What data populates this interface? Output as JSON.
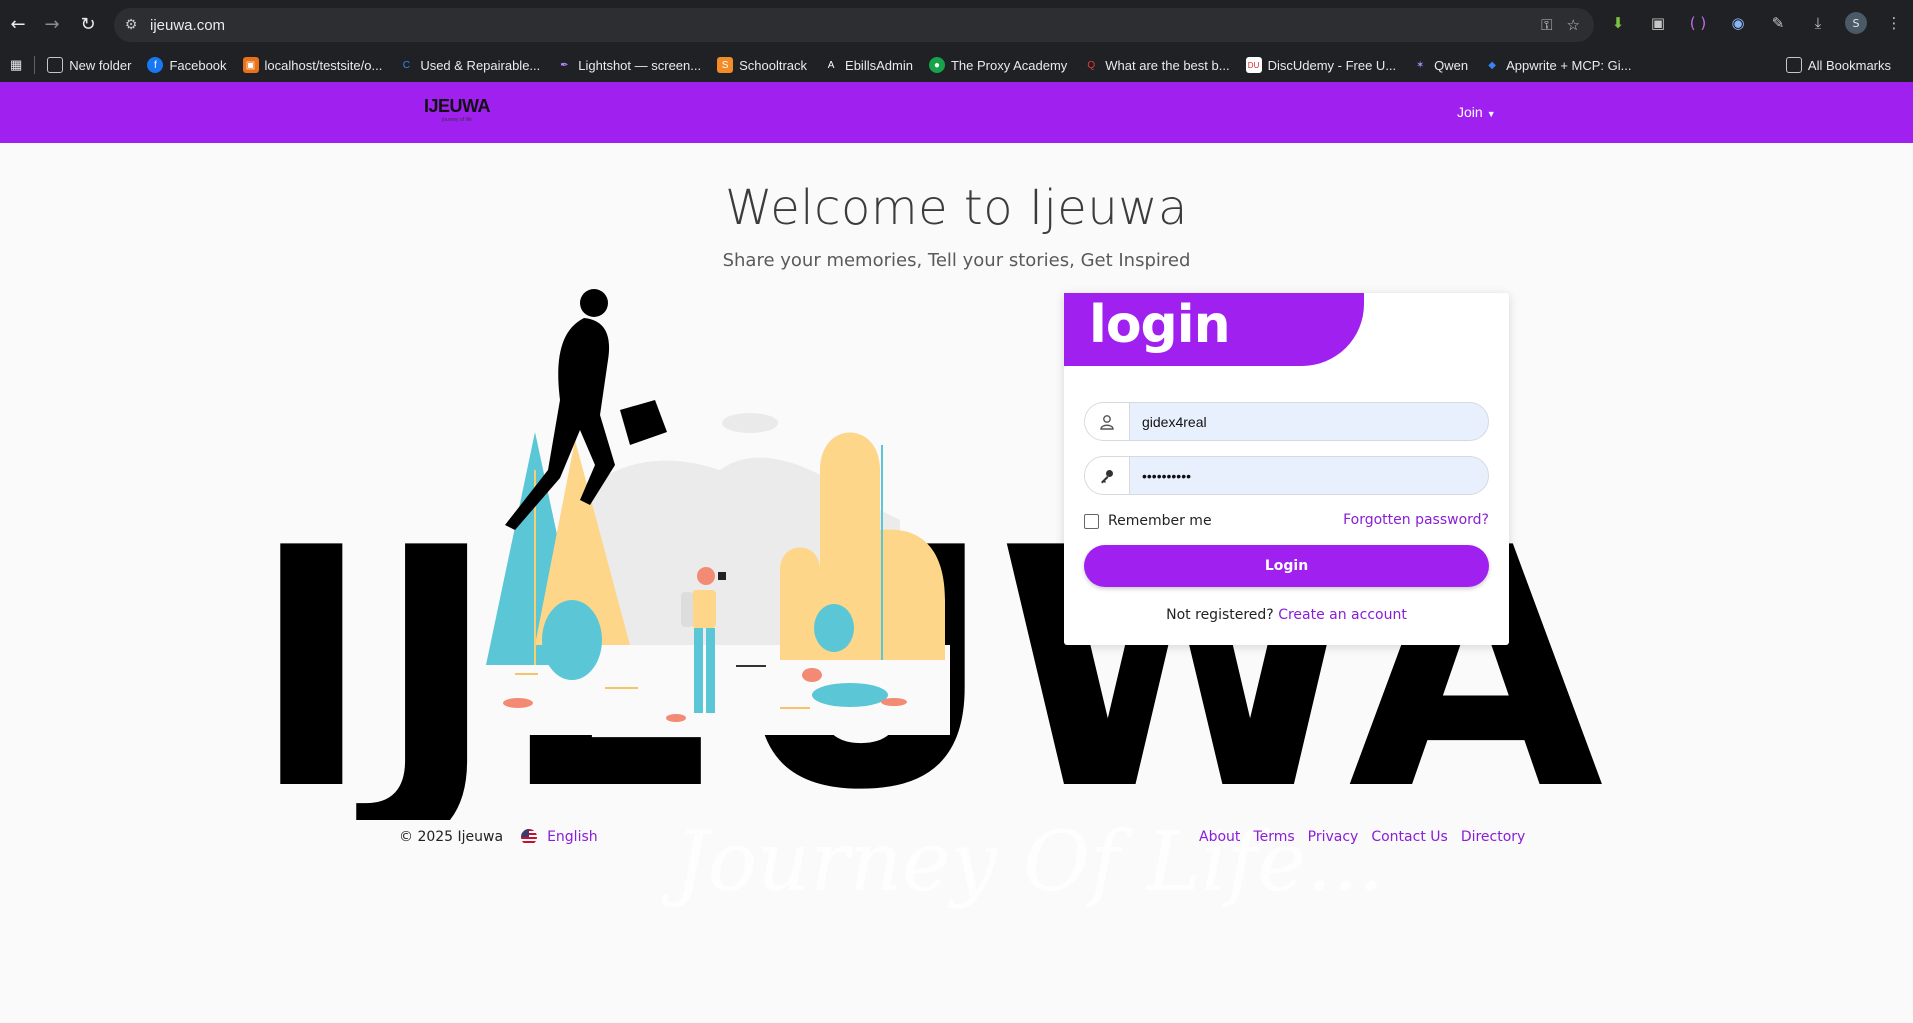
{
  "browser": {
    "url": "ijeuwa.com",
    "profile_initial": "S",
    "bookmarks": [
      {
        "label": "New folder",
        "icon": "folder-icon"
      },
      {
        "label": "Facebook",
        "icon": "facebook-icon"
      },
      {
        "label": "localhost/testsite/o...",
        "icon": "localhost-icon"
      },
      {
        "label": "Used & Repairable...",
        "icon": "used-repairable-icon"
      },
      {
        "label": "Lightshot — screen...",
        "icon": "lightshot-icon"
      },
      {
        "label": "Schooltrack",
        "icon": "schooltrack-icon"
      },
      {
        "label": "EbillsAdmin",
        "icon": "ebills-icon"
      },
      {
        "label": "The Proxy Academy",
        "icon": "proxy-academy-icon"
      },
      {
        "label": "What are the best b...",
        "icon": "quora-icon"
      },
      {
        "label": "DiscUdemy - Free U...",
        "icon": "discudemy-icon"
      },
      {
        "label": "Qwen",
        "icon": "qwen-icon"
      },
      {
        "label": "Appwrite + MCP: Gi...",
        "icon": "appwrite-icon"
      }
    ],
    "all_bookmarks": "All Bookmarks"
  },
  "header": {
    "logo_text": "IJEUWA",
    "logo_sub": "journey of life",
    "join_label": "Join"
  },
  "hero": {
    "title": "Welcome to Ijeuwa",
    "subtitle": "Share your memories, Tell your stories, Get Inspired",
    "big_word": "IJEUWA",
    "tagline": "Journey Of Life..."
  },
  "login": {
    "heading": "login",
    "username_value": "gidex4real",
    "password_value": "••••••••••",
    "remember_label": "Remember me",
    "forgot_label": "Forgotten password?",
    "button_label": "Login",
    "not_registered": "Not registered?",
    "create_account": "Create an account"
  },
  "footer": {
    "copyright": "© 2025 Ijeuwa",
    "language": "English",
    "links": [
      "About",
      "Terms",
      "Privacy",
      "Contact Us",
      "Directory"
    ]
  },
  "colors": {
    "brand_purple": "#a020f0",
    "link_purple": "#8a1dd6",
    "input_bg": "#e8f0fe"
  }
}
